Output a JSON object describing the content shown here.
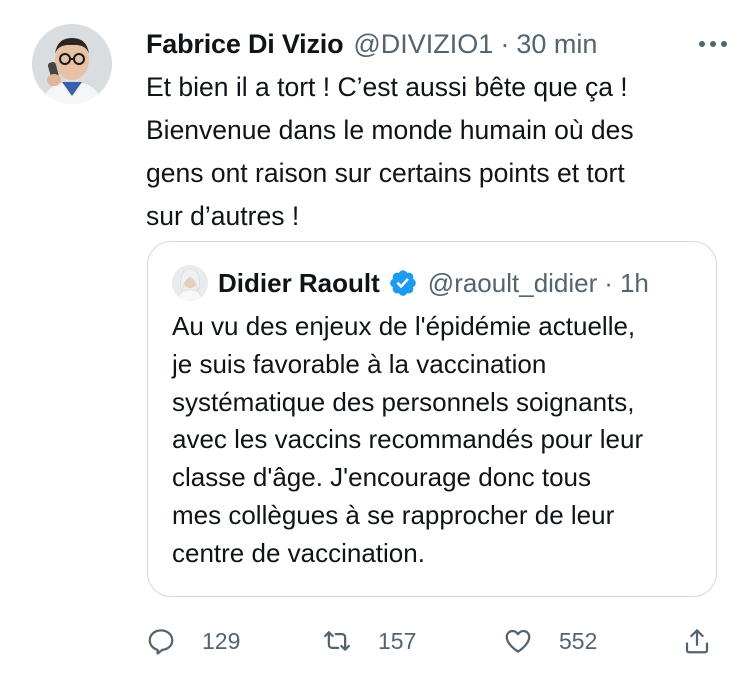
{
  "tweet": {
    "author_name": "Fabrice Di Vizio",
    "handle": "@DIVIZIO1",
    "separator": "·",
    "time": "30 min",
    "avatar_icon": "person-on-phone-avatar",
    "more_icon": "more-horizontal-icon",
    "text_lines": [
      "Et bien il a tort ! C’est aussi bête que ça !",
      "Bienvenue dans le monde humain où des",
      "gens ont raison sur certains points et tort",
      "sur d’autres !"
    ]
  },
  "quote": {
    "author_name": "Didier Raoult",
    "verified_icon": "verified-badge-icon",
    "handle": "@raoult_didier",
    "separator": "·",
    "time": "1h",
    "text_lines": [
      "Au vu des enjeux de l'épidémie actuelle,",
      "je suis favorable à la vaccination",
      "systématique des personnels soignants,",
      "avec les vaccins recommandés pour leur",
      "classe d'âge. J'encourage donc tous",
      "mes collègues à se rapprocher de leur",
      "centre de vaccination."
    ]
  },
  "actions": {
    "reply": {
      "icon": "reply-icon",
      "count": "129"
    },
    "retweet": {
      "icon": "retweet-icon",
      "count": "157"
    },
    "like": {
      "icon": "heart-icon",
      "count": "552"
    },
    "share": {
      "icon": "share-icon"
    }
  },
  "colors": {
    "text_primary": "#0f1419",
    "text_secondary": "#536471",
    "border": "#cfd9de",
    "verified_blue": "#1d9bf0"
  }
}
